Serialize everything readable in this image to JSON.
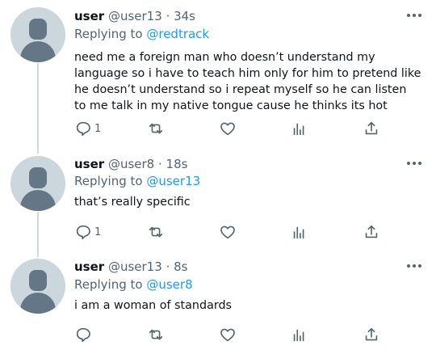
{
  "tweets": [
    {
      "name": "user",
      "handle": "@user13",
      "time": "· 34s",
      "replying_prefix": "Replying to",
      "replying_to": "@redtrack",
      "text": "need me a foreign man who doesn’t understand my language so i have to teach him only for him to pretend like he doesn’t understand so i repeat myself so he can listen to me talk in my native tongue cause he thinks its hot",
      "reply_count": "1",
      "icons": [
        "reply-icon",
        "retweet-icon",
        "like-icon",
        "views-icon",
        "share-icon"
      ]
    },
    {
      "name": "user",
      "handle": "@user8",
      "time": "· 18s",
      "replying_prefix": "Replying to",
      "replying_to": "@user13",
      "text": "that’s really specific",
      "reply_count": "1",
      "icons": [
        "reply-icon",
        "retweet-icon",
        "like-icon",
        "views-icon",
        "share-icon"
      ]
    },
    {
      "name": "user",
      "handle": "@user13",
      "time": "· 8s",
      "replying_prefix": "Replying to",
      "replying_to": "@user8",
      "text": "i am a woman of standards",
      "reply_count": "",
      "icons": [
        "reply-icon",
        "retweet-icon",
        "like-icon",
        "views-icon",
        "share-icon"
      ]
    }
  ],
  "colors": {
    "link": "#1d9bf0",
    "secondary": "#536471",
    "thread_line": "#cfd9de",
    "avatar_bg": "#ccd6dd",
    "avatar_fg": "#657786"
  }
}
